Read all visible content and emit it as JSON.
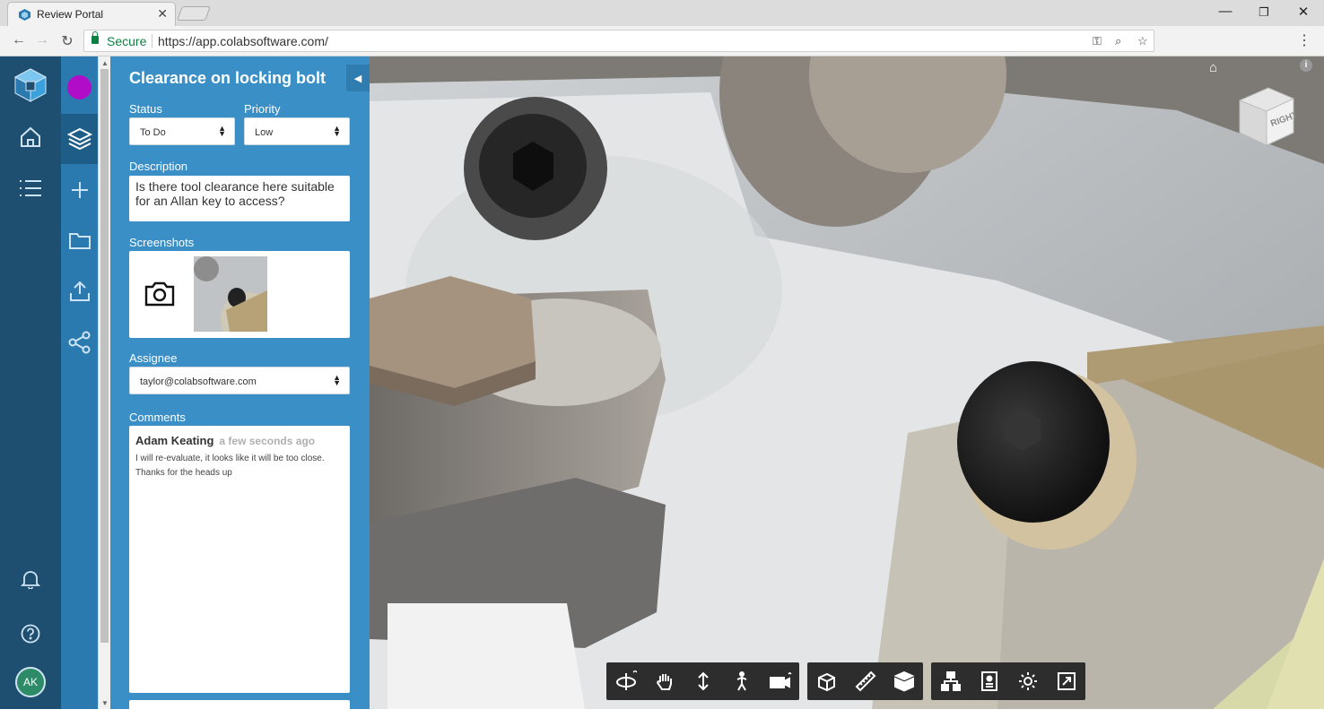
{
  "browser": {
    "tab_title": "Review Portal",
    "secure_label": "Secure",
    "url_scheme": "https://",
    "url_host": "app.colabsoftware.com/"
  },
  "nav": {
    "rail_items": [
      "home-icon",
      "list-icon"
    ],
    "project_color": "#b10dc9",
    "avatar_initials": "AK"
  },
  "issue": {
    "title": "Clearance on locking bolt",
    "status_label": "Status",
    "status_value": "To Do",
    "priority_label": "Priority",
    "priority_value": "Low",
    "description_label": "Description",
    "description": "Is there tool clearance here suitable for an Allan key to access?",
    "screenshots_label": "Screenshots",
    "assignee_label": "Assignee",
    "assignee_value": "taylor@colabsoftware.com",
    "comments_label": "Comments",
    "comments": [
      {
        "author": "Adam Keating",
        "time": "a few seconds ago",
        "text": "I will re-evaluate, it looks like it will be too close. Thanks for the heads up"
      }
    ]
  },
  "viewcube": {
    "face_label": "RIGHT"
  },
  "colors": {
    "rail": "#1e4f70",
    "secondary_rail": "#2a7ab0",
    "panel": "#3a8fc6",
    "toolbar": "#2d2d2d"
  }
}
